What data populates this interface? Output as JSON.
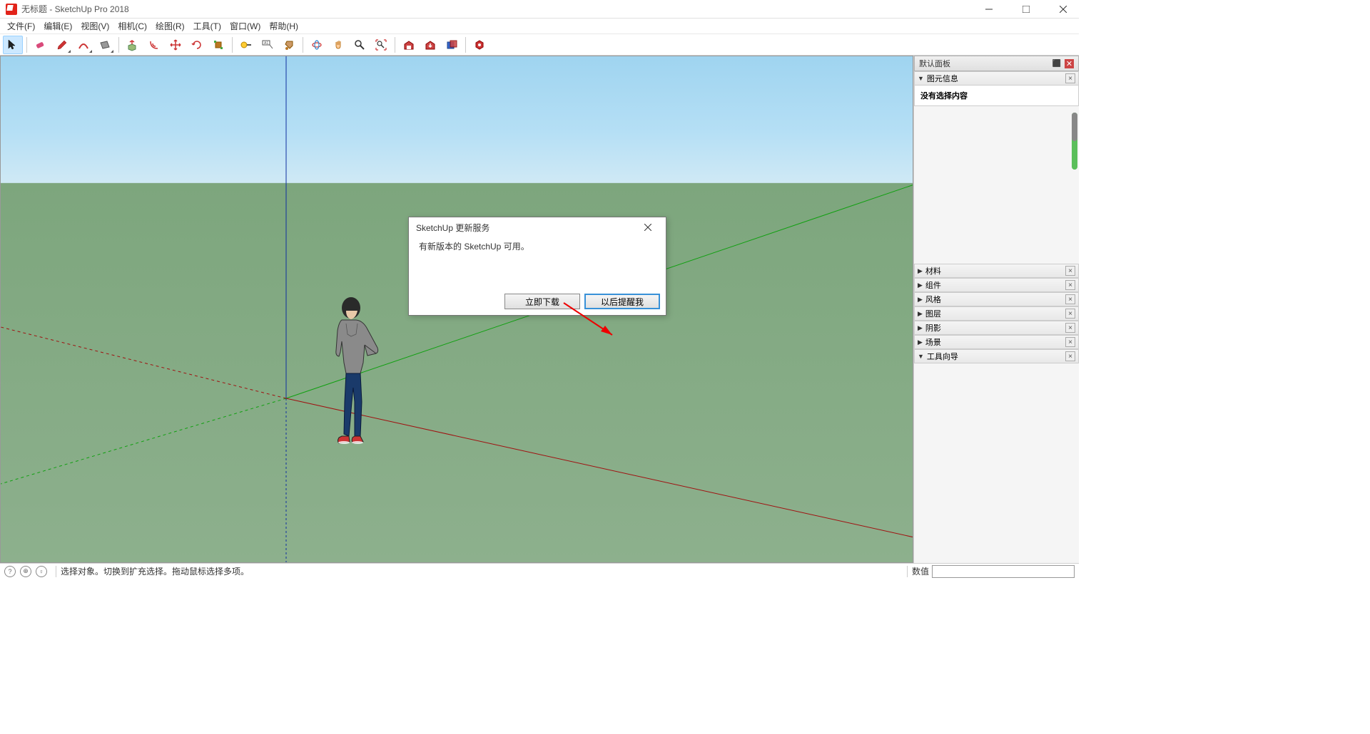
{
  "titlebar": {
    "title": "无标题 - SketchUp Pro 2018"
  },
  "menu": {
    "items": [
      "文件(F)",
      "编辑(E)",
      "视图(V)",
      "相机(C)",
      "绘图(R)",
      "工具(T)",
      "窗口(W)",
      "帮助(H)"
    ]
  },
  "toolbar": {
    "groups": [
      [
        "select-tool"
      ],
      [
        "eraser-tool",
        "pencil-tool",
        "arc-tool",
        "rectangle-tool"
      ],
      [
        "pushpull-tool",
        "offset-tool",
        "move-tool",
        "rotate-tool",
        "scale-tool"
      ],
      [
        "tape-tool",
        "text-tool",
        "paint-tool"
      ],
      [
        "orbit-tool",
        "pan-tool",
        "zoom-tool",
        "zoom-extents-tool"
      ],
      [
        "warehouse-tool",
        "getmodels-tool",
        "share-tool"
      ],
      [
        "extension-tool"
      ]
    ]
  },
  "sidepanel": {
    "header": "默认面板",
    "entity_info": {
      "title": "图元信息",
      "content": "没有选择内容"
    },
    "sections": [
      "材料",
      "组件",
      "风格",
      "图层",
      "阴影",
      "场景",
      "工具向导"
    ]
  },
  "statusbar": {
    "hint": "选择对象。切换到扩充选择。拖动鼠标选择多项。",
    "value_label": "数值"
  },
  "modal": {
    "title": "SketchUp 更新服务",
    "body": "有新版本的 SketchUp 可用。",
    "btn_download": "立即下载",
    "btn_remind": "以后提醒我"
  }
}
